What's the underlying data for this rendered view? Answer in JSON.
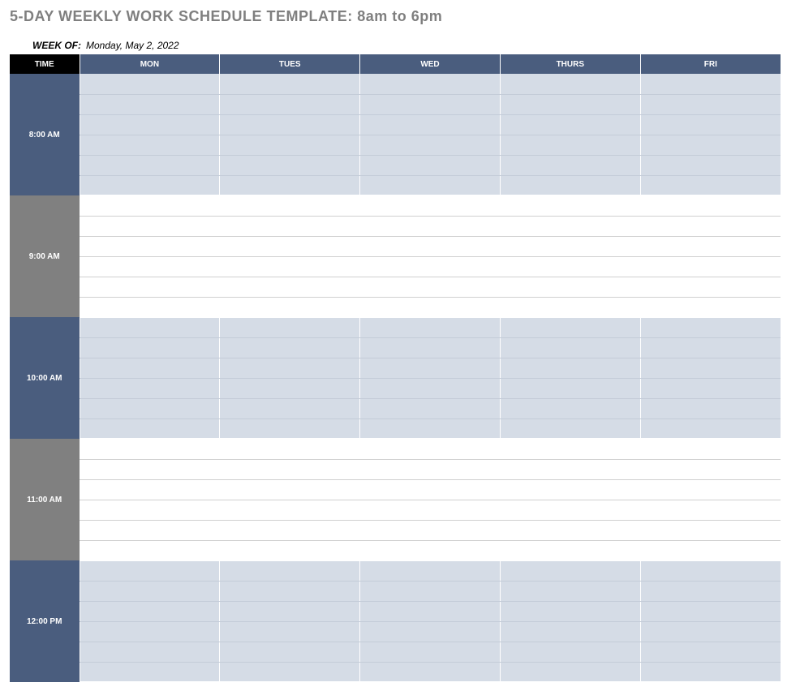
{
  "title": "5-DAY WEEKLY WORK SCHEDULE TEMPLATE: 8am to 6pm",
  "week_of_label": "WEEK OF:",
  "week_of_value": "Monday, May 2, 2022",
  "columns": {
    "time": "TIME",
    "days": [
      "MON",
      "TUES",
      "WED",
      "THURS",
      "FRI"
    ]
  },
  "time_blocks": [
    {
      "label": "8:00 AM",
      "style": "dark",
      "cell_style": "blue",
      "rows": 6
    },
    {
      "label": "9:00 AM",
      "style": "gray",
      "cell_style": "white",
      "rows": 6
    },
    {
      "label": "10:00 AM",
      "style": "dark",
      "cell_style": "blue",
      "rows": 6
    },
    {
      "label": "11:00 AM",
      "style": "gray",
      "cell_style": "white",
      "rows": 6
    },
    {
      "label": "12:00 PM",
      "style": "dark",
      "cell_style": "blue",
      "rows": 6
    }
  ]
}
